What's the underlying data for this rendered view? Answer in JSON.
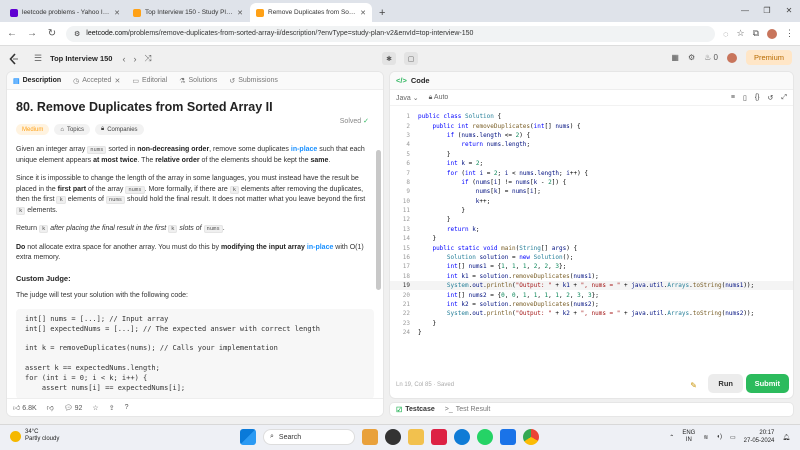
{
  "browser": {
    "tabs": [
      {
        "title": "leetcode problems - Yahoo Indi",
        "favicon_color": "#6001d2",
        "active": false
      },
      {
        "title": "Top Interview 150 - Study Plan",
        "favicon_color": "#ffa116",
        "active": false
      },
      {
        "title": "Remove Duplicates from Sorte",
        "favicon_color": "#ffa116",
        "active": true
      }
    ],
    "new_tab_glyph": "+",
    "url_host": "leetcode.com",
    "url_path": "/problems/remove-duplicates-from-sorted-array-ii/description/?envType=study-plan-v2&envId=top-interview-150"
  },
  "header": {
    "list_name": "Top Interview 150",
    "fire_count": "0",
    "premium_label": "Premium"
  },
  "left": {
    "tabs": {
      "description": "Description",
      "accepted": "Accepted",
      "editorial": "Editorial",
      "solutions": "Solutions",
      "submissions": "Submissions"
    },
    "title": "80. Remove Duplicates from Sorted Array II",
    "solved_label": "Solved",
    "pills": {
      "difficulty": "Medium",
      "topics": "Topics",
      "companies": "Companies"
    },
    "p1": {
      "a": "Given an integer array ",
      "code1": "nums",
      "b": " sorted in ",
      "bold1": "non-decreasing order",
      "c": ", remove some duplicates ",
      "link1": "in-place",
      "d": " such that each unique element appears ",
      "bold2": "at most twice",
      "e": ". The ",
      "bold3": "relative order",
      "f": " of the elements should be kept the ",
      "bold4": "same",
      "g": "."
    },
    "p2": {
      "a": "Since it is impossible to change the length of the array in some languages, you must instead have the result be placed in the ",
      "bold1": "first part",
      "b": " of the array ",
      "code1": "nums",
      "c": ". More formally, if there are ",
      "code2": "k",
      "d": " elements after removing the duplicates, then the first ",
      "code3": "k",
      "e": " elements of ",
      "code4": "nums",
      "f": " should hold the final result. It does not matter what you leave beyond the first ",
      "code5": "k",
      "g": " elements."
    },
    "p3": {
      "a": "Return ",
      "code1": "k",
      "b": " after placing the final result in the first ",
      "code2": "k",
      "c": " slots of ",
      "code3": "nums",
      "d": "."
    },
    "p4": {
      "bold1": "Do",
      "a": " not allocate extra space for another array. You must do this by ",
      "bold2": "modifying the input array",
      "link1": "in-place",
      "b": " with O(1) extra memory."
    },
    "custom_judge_heading": "Custom Judge:",
    "judge_intro": "The judge will test your solution with the following code:",
    "judge_code": [
      "int[] nums = [...]; // Input array",
      "int[] expectedNums = [...]; // The expected answer with correct length",
      "",
      "int k = removeDuplicates(nums); // Calls your implementation",
      "",
      "assert k == expectedNums.length;",
      "for (int i = 0; i < k; i++) {",
      "    assert nums[i] == expectedNums[i];"
    ],
    "footer": {
      "likes": "6.8K",
      "comments": "92"
    }
  },
  "right": {
    "title": "Code",
    "language": "Java",
    "auto_label": "Auto",
    "status": "Ln 19, Col 85  ·  Saved",
    "run_label": "Run",
    "submit_label": "Submit",
    "code_lines": [
      "public class Solution {",
      "    public int removeDuplicates(int[] nums) {",
      "        if (nums.length <= 2) {",
      "            return nums.length;",
      "        }",
      "        int k = 2;",
      "        for (int i = 2; i < nums.length; i++) {",
      "            if (nums[i] != nums[k - 2]) {",
      "                nums[k] = nums[i];",
      "                k++;",
      "            }",
      "        }",
      "        return k;",
      "    }",
      "    public static void main(String[] args) {",
      "        Solution solution = new Solution();",
      "        int[] nums1 = {1, 1, 1, 2, 2, 3};",
      "        int k1 = solution.removeDuplicates(nums1);",
      "        System.out.println(\"Output: \" + k1 + \", nums = \" + java.util.Arrays.toString(nums1));",
      "        int[] nums2 = {0, 0, 1, 1, 1, 1, 2, 3, 3};",
      "        int k2 = solution.removeDuplicates(nums2);",
      "        System.out.println(\"Output: \" + k2 + \", nums = \" + java.util.Arrays.toString(nums2));",
      "    }",
      "}"
    ],
    "current_line": 19
  },
  "bottom": {
    "testcase_label": "Testcase",
    "test_result_label": "Test Result"
  },
  "taskbar": {
    "temp": "34°C",
    "weather": "Partly cloudy",
    "search_placeholder": "Search",
    "lang1": "ENG",
    "lang2": "IN",
    "time": "20:17",
    "date": "27-05-2024"
  }
}
